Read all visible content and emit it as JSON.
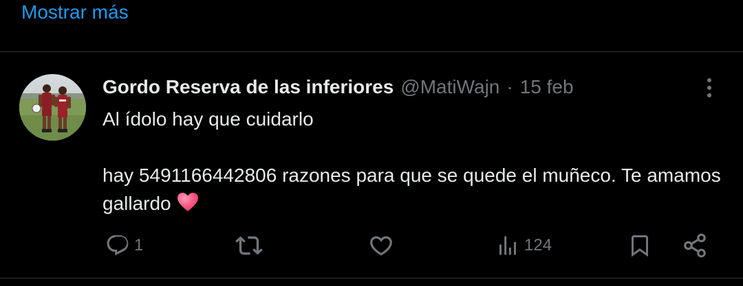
{
  "show_more": {
    "label": "Mostrar más"
  },
  "tweet": {
    "display_name": "Gordo Reserva de las inferiores",
    "handle": "@MatiWajn",
    "separator": "·",
    "date": "15 feb",
    "text_line1": "Al ídolo hay que cuidarlo",
    "text_line2": "hay 5491166442806 razones para que se quede el muñeco. Te amamos gallardo",
    "emoji": "pink-heart",
    "avatar": "two-soccer-players-photo",
    "stats": {
      "replies": "1",
      "reposts": "",
      "likes": "",
      "views": "124"
    }
  },
  "icons": {
    "more": "more-vertical-icon",
    "reply": "reply-icon",
    "repost": "repost-icon",
    "like": "like-icon",
    "views": "views-icon",
    "bookmark": "bookmark-icon",
    "share": "share-icon"
  },
  "colors": {
    "background": "#000000",
    "text_primary": "#e7e9ea",
    "text_secondary": "#71767b",
    "link": "#1d9bf0",
    "divider": "#2f3336",
    "heart": "#f7537f"
  }
}
